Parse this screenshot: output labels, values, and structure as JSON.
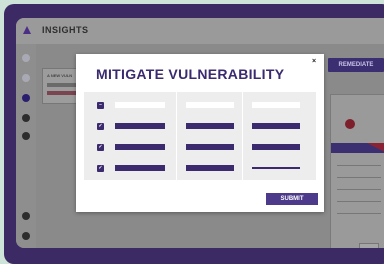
{
  "app": {
    "brand": "INSIGHTS"
  },
  "background": {
    "panel_caption": "A NEW VULN",
    "remediate_label": "REMEDIATE"
  },
  "modal": {
    "title": "MITIGATE VULNERABILITY",
    "close_label": "×",
    "header_select_state": "indeterminate",
    "rows": [
      {
        "checked": true
      },
      {
        "checked": true
      },
      {
        "checked": true
      }
    ],
    "submit_label": "SUBMIT"
  },
  "colors": {
    "accent": "#3b2a6e",
    "frame": "#3b2a63",
    "danger": "#8b2233"
  },
  "icons": [
    "logo-icon",
    "close-icon",
    "checkbox-icon",
    "skull-icon"
  ]
}
